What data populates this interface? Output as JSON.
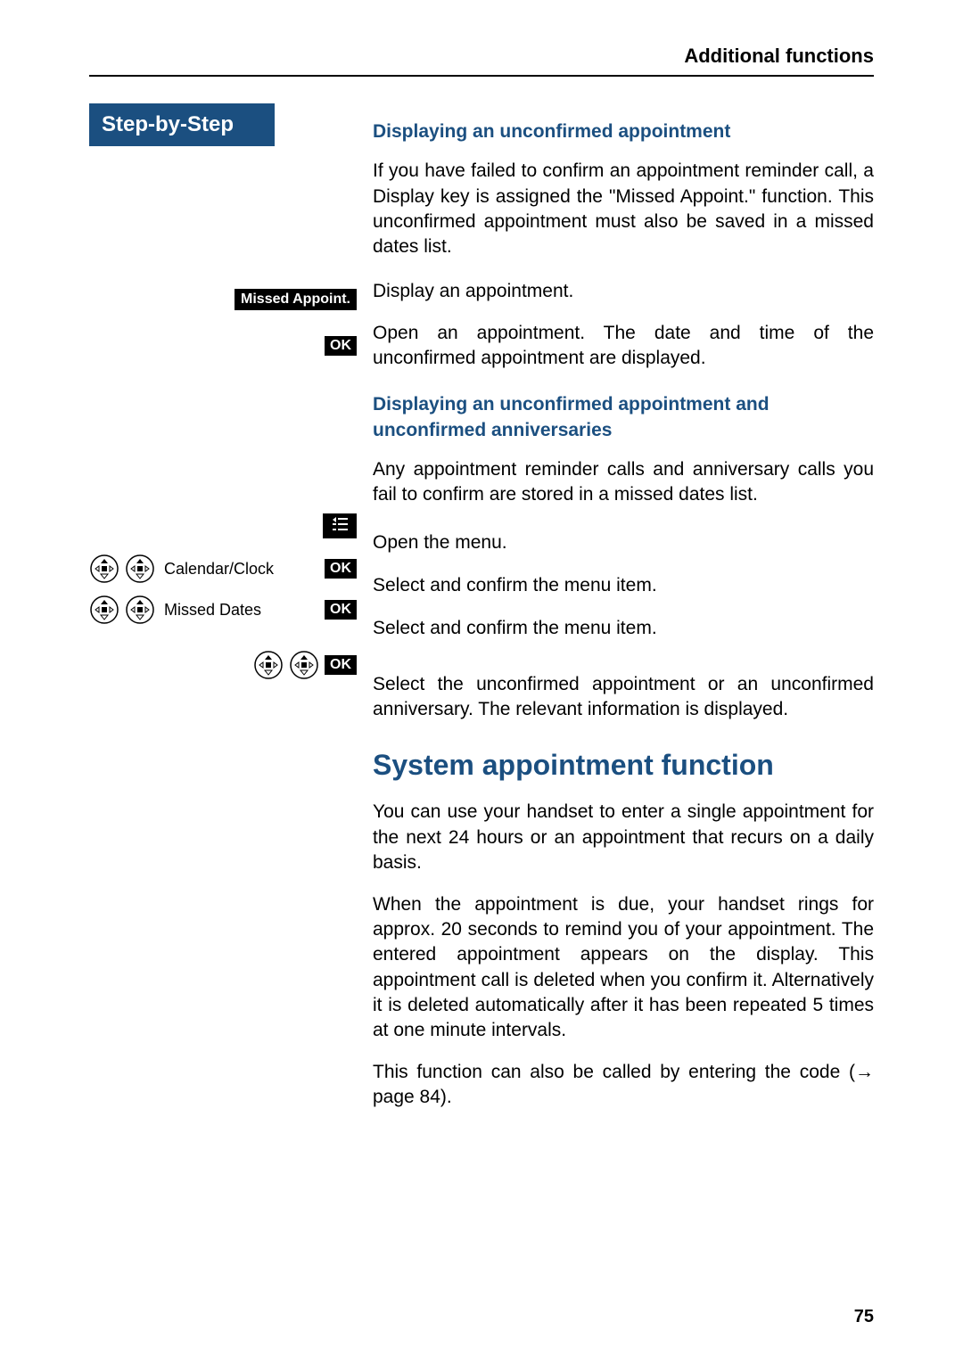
{
  "header": {
    "title": "Additional functions"
  },
  "sidebar": {
    "step_title": "Step-by-Step",
    "rows": [
      {
        "type": "pill",
        "text": "Missed Appoint."
      },
      {
        "type": "ok"
      },
      {
        "type": "menu"
      },
      {
        "type": "nav-label-ok",
        "label": "Calendar/Clock"
      },
      {
        "type": "nav-label-ok",
        "label": "Missed Dates"
      },
      {
        "type": "nav-ok"
      }
    ]
  },
  "content": {
    "sub1": "Displaying an unconfirmed appointment",
    "p1": "If you have failed to confirm an appointment reminder call, a Display key is assigned the \"Missed Appoint.\" function. This unconfirmed appointment must also be saved in a missed dates list.",
    "s1": "Display an appointment.",
    "s2": "Open an appointment. The date and time of the unconfirmed appointment are displayed.",
    "sub2": "Displaying an unconfirmed appointment and unconfirmed anniversaries",
    "p2": "Any appointment reminder calls and anniversary calls you fail to confirm are stored in a missed dates list.",
    "s3": "Open the menu.",
    "s4": "Select and confirm the menu item.",
    "s5": "Select and confirm the menu item.",
    "s6": "Select the unconfirmed appointment or an unconfirmed anniversary. The relevant information is displayed.",
    "h1": "System appointment function",
    "p3": "You can use your handset to enter a single appointment for the next 24 hours or an appointment that recurs on a daily basis.",
    "p4": "When the appointment is due, your handset rings for approx. 20 seconds to remind you of your appointment. The entered appointment appears on the display. This appointment call is deleted when you confirm it. Alternatively it is deleted automatically after it has been repeated 5 times at one minute intervals.",
    "p5a": "This function can also be called by entering the code (",
    "p5b": " page 84)."
  },
  "page_number": "75"
}
